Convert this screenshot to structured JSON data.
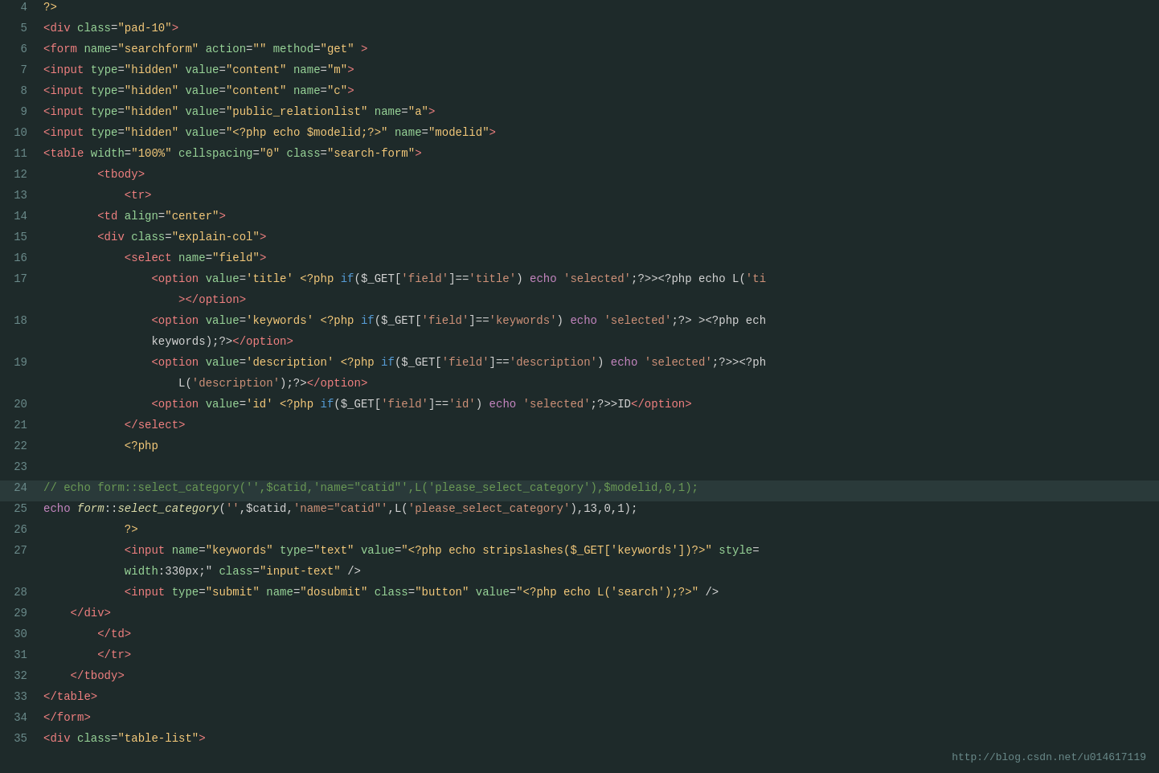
{
  "editor": {
    "background": "#1e2a2a",
    "watermark": "http://blog.csdn.net/u014617119",
    "lines": [
      {
        "num": 4,
        "highlighted": false,
        "content": "?>"
      },
      {
        "num": 5,
        "highlighted": false,
        "content": "<div class=\"pad-10\">"
      },
      {
        "num": 6,
        "highlighted": false,
        "content": "<form name=\"searchform\" action=\"\" method=\"get\" >"
      },
      {
        "num": 7,
        "highlighted": false,
        "content": "<input type=\"hidden\" value=\"content\" name=\"m\">"
      },
      {
        "num": 8,
        "highlighted": false,
        "content": "<input type=\"hidden\" value=\"content\" name=\"c\">"
      },
      {
        "num": 9,
        "highlighted": false,
        "content": "<input type=\"hidden\" value=\"public_relationlist\" name=\"a\">"
      },
      {
        "num": 10,
        "highlighted": false,
        "content": "<input type=\"hidden\" value=\"<?php echo $modelid;?>\" name=\"modelid\">"
      },
      {
        "num": 11,
        "highlighted": false,
        "content": "<table width=\"100%\" cellspacing=\"0\" class=\"search-form\">"
      },
      {
        "num": 12,
        "highlighted": false,
        "content": "    <tbody>"
      },
      {
        "num": 13,
        "highlighted": false,
        "content": "        <tr>"
      },
      {
        "num": 14,
        "highlighted": false,
        "content": "        <td align=\"center\">"
      },
      {
        "num": 15,
        "highlighted": false,
        "content": "        <div class=\"explain-col\">"
      },
      {
        "num": 16,
        "highlighted": false,
        "content": "            <select name=\"field\">"
      },
      {
        "num": 17,
        "highlighted": false,
        "content": "                <option value='title' <?php if($_GET['field']=='title') echo 'selected';?>><?php echo L('ti"
      },
      {
        "num": -1,
        "highlighted": false,
        "content": "                    ></option>"
      },
      {
        "num": 18,
        "highlighted": false,
        "content": "                <option value='keywords' <?php if($_GET['field']=='keywords') echo 'selected';?> ><?php ech"
      },
      {
        "num": -1,
        "highlighted": false,
        "content": "                keywords);?></option>"
      },
      {
        "num": 19,
        "highlighted": false,
        "content": "                <option value='description' <?php if($_GET['field']=='description') echo 'selected';?>><?ph"
      },
      {
        "num": -1,
        "highlighted": false,
        "content": "                    L('description');?></option>"
      },
      {
        "num": 20,
        "highlighted": false,
        "content": "                <option value='id' <?php if($_GET['field']=='id') echo 'selected';?>>ID</option>"
      },
      {
        "num": 21,
        "highlighted": false,
        "content": "            </select>"
      },
      {
        "num": 22,
        "highlighted": false,
        "content": "            <?php"
      },
      {
        "num": 23,
        "highlighted": false,
        "content": ""
      },
      {
        "num": 24,
        "highlighted": true,
        "content": "// echo form::select_category('',$catid,'name=\"catid\"',L('please_select_category'),$modelid,0,1);"
      },
      {
        "num": 25,
        "highlighted": false,
        "content": "echo form::select_category('',$catid,'name=\"catid\"',L('please_select_category'),13,0,1);"
      },
      {
        "num": 26,
        "highlighted": false,
        "content": "            ?>"
      },
      {
        "num": 27,
        "highlighted": false,
        "content": "            <input name=\"keywords\" type=\"text\" value=\"<?php echo stripslashes($_GET['keywords'])?>\" style="
      },
      {
        "num": -1,
        "highlighted": false,
        "content": "            width:330px;\" class=\"input-text\" />"
      },
      {
        "num": 28,
        "highlighted": false,
        "content": "            <input type=\"submit\" name=\"dosubmit\" class=\"button\" value=\"<?php echo L('search');?>\" />"
      },
      {
        "num": 29,
        "highlighted": false,
        "content": "    </div>"
      },
      {
        "num": 30,
        "highlighted": false,
        "content": "        </td>"
      },
      {
        "num": 31,
        "highlighted": false,
        "content": "        </tr>"
      },
      {
        "num": 32,
        "highlighted": false,
        "content": "    </tbody>"
      },
      {
        "num": 33,
        "highlighted": false,
        "content": "</table>"
      },
      {
        "num": 34,
        "highlighted": false,
        "content": "</form>"
      },
      {
        "num": 35,
        "highlighted": false,
        "content": "<div class=\"table-list\">"
      }
    ]
  }
}
